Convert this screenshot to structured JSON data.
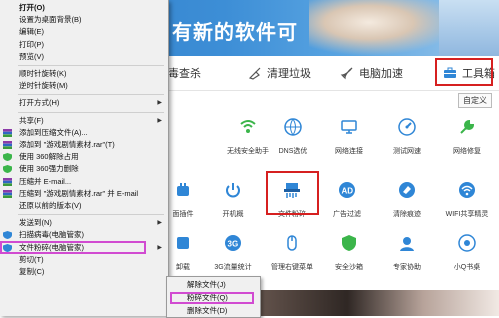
{
  "app": {
    "banner_text": "有新的软件可",
    "nav": [
      {
        "label": "毒查杀",
        "icon": "shield-icon"
      },
      {
        "label": "清理垃圾",
        "icon": "broom-icon"
      },
      {
        "label": "电脑加速",
        "icon": "rocket-icon"
      },
      {
        "label": "工具箱",
        "icon": "toolbox-icon"
      }
    ],
    "settings_label": "自定义",
    "tools_row1": [
      {
        "label": "无线安全助手",
        "icon": "wifi-shield-icon",
        "color": "#3bb54a"
      },
      {
        "label": "DNS选优",
        "icon": "dns-icon",
        "color": "#2f86d6"
      },
      {
        "label": "网络连接",
        "icon": "network-icon",
        "color": "#2f86d6"
      },
      {
        "label": "测试网速",
        "icon": "speed-test-icon",
        "color": "#2f86d6"
      },
      {
        "label": "网络修复",
        "icon": "wrench-icon",
        "color": "#3bb54a"
      }
    ],
    "tools_row2": [
      {
        "label": "面插件",
        "icon": "plugin-icon",
        "color": "#2f86d6"
      },
      {
        "label": "开机概",
        "icon": "power-icon",
        "color": "#2f86d6"
      },
      {
        "label": "文件粉碎",
        "icon": "shredder-icon",
        "color": "#2f86d6"
      },
      {
        "label": "广告过滤",
        "icon": "ad-filter-icon",
        "color": "#2f86d6"
      },
      {
        "label": "清除痕迹",
        "icon": "eraser-icon",
        "color": "#2f86d6"
      },
      {
        "label": "WIFI共享精灵",
        "icon": "wifi-share-icon",
        "color": "#2f86d6"
      }
    ],
    "tools_row3": [
      {
        "label": "卸载",
        "icon": "uninstall-icon",
        "color": "#2f86d6"
      },
      {
        "label": "3G流量统计",
        "icon": "3g-icon",
        "color": "#2f86d6"
      },
      {
        "label": "管理右键菜单",
        "icon": "mouse-icon",
        "color": "#2f86d6"
      },
      {
        "label": "安全沙箱",
        "icon": "sandbox-icon",
        "color": "#3bb54a"
      },
      {
        "label": "专家协助",
        "icon": "expert-icon",
        "color": "#2f86d6"
      },
      {
        "label": "小Q书桌",
        "icon": "q-desk-icon",
        "color": "#2f86d6"
      }
    ]
  },
  "menu": [
    {
      "label": "打开(O)",
      "bold": true,
      "icon": ""
    },
    {
      "label": "设置为桌面背景(B)",
      "icon": ""
    },
    {
      "label": "编辑(E)",
      "icon": ""
    },
    {
      "label": "打印(P)",
      "icon": ""
    },
    {
      "label": "预览(V)",
      "icon": ""
    },
    {
      "sep": true
    },
    {
      "label": "顺时针旋转(K)",
      "icon": ""
    },
    {
      "label": "逆时针旋转(M)",
      "icon": ""
    },
    {
      "sep": true
    },
    {
      "label": "打开方式(H)",
      "icon": "",
      "arrow": true
    },
    {
      "sep": true
    },
    {
      "label": "共享(F)",
      "icon": "",
      "arrow": true
    },
    {
      "label": "添加到压缩文件(A)...",
      "icon": "winrar-icon"
    },
    {
      "label": "添加到 \"游戏剧情素材.rar\"(T)",
      "icon": "winrar-icon"
    },
    {
      "label": "使用 360解除占用",
      "icon": "360-icon"
    },
    {
      "label": "使用 360强力删除",
      "icon": "360-icon"
    },
    {
      "label": "压缩并 E-mail...",
      "icon": "winrar-icon"
    },
    {
      "label": "压缩到 \"游戏剧情素材.rar\" 并 E-mail",
      "icon": "winrar-icon"
    },
    {
      "label": "还原以前的版本(V)",
      "icon": ""
    },
    {
      "sep": true
    },
    {
      "label": "发送到(N)",
      "icon": "",
      "arrow": true
    },
    {
      "label": "扫描病毒(电脑管家)",
      "icon": "tencent-shield-icon"
    },
    {
      "label": "文件粉碎(电脑管家)",
      "icon": "tencent-shield-icon",
      "arrow": true,
      "highlight": true
    },
    {
      "label": "剪切(T)",
      "icon": ""
    },
    {
      "label": "复制(C)",
      "icon": ""
    }
  ],
  "submenu": [
    {
      "label": "解除文件(J)"
    },
    {
      "label": "粉碎文件(Q)",
      "highlight": true
    },
    {
      "label": "删除文件(D)"
    }
  ]
}
